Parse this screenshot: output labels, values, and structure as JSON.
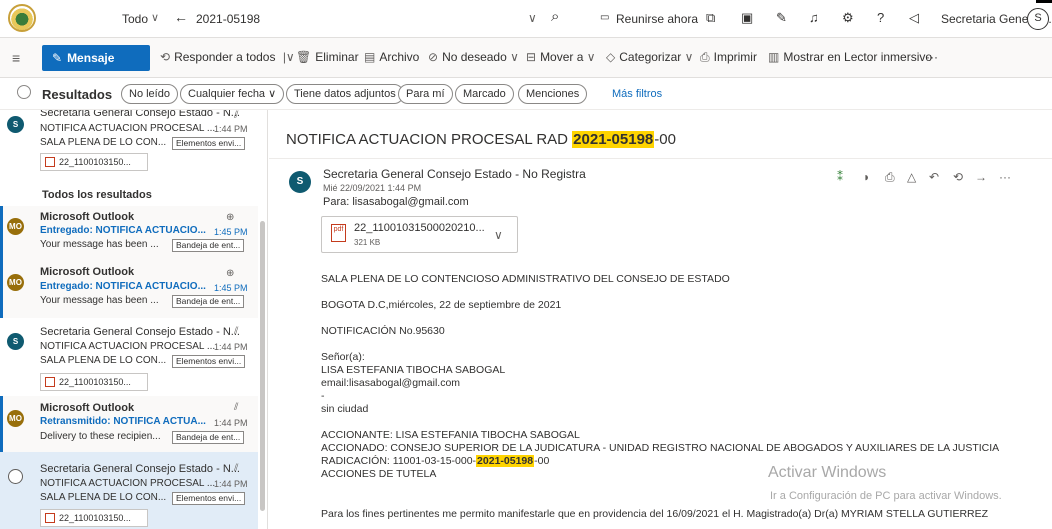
{
  "header": {
    "search_scope": "Todo",
    "search_query": "2021-05198",
    "meet_now": "Reunirse ahora",
    "user_name": "Secretaria General...",
    "user_initial": "S"
  },
  "commands": {
    "new_mail": "Mensaje nuevo",
    "reply_all": "Responder a todos",
    "delete": "Eliminar",
    "archive": "Archivo",
    "junk": "No deseado",
    "move_to": "Mover a",
    "categorize": "Categorizar",
    "print": "Imprimir",
    "immersive_reader": "Mostrar en Lector inmersivo",
    "more": "···"
  },
  "filters": {
    "results_label": "Resultados",
    "chips": [
      "No leído",
      "Cualquier fecha",
      "Tiene datos adjuntos",
      "Para mí",
      "Marcado",
      "Menciones"
    ],
    "more_filters": "Más filtros"
  },
  "list": {
    "section_title": "Todos los resultados",
    "top_item": {
      "sender": "Secretaria General Consejo Estado - N...",
      "subject": "NOTIFICA ACTUACION PROCESAL ...",
      "time": "1:44 PM",
      "preview": "SALA PLENA DE LO CON...",
      "folder": "Elementos envi...",
      "attachment": "22_1100103150...",
      "avatar": "S"
    },
    "items": [
      {
        "sender": "Microsoft Outlook",
        "subject": "Entregado: NOTIFICA ACTUACIO...",
        "time": "1:45 PM",
        "preview": "Your message has been ...",
        "folder": "Bandeja de ent...",
        "avatar": "MO"
      },
      {
        "sender": "Microsoft Outlook",
        "subject": "Entregado: NOTIFICA ACTUACIO...",
        "time": "1:45 PM",
        "preview": "Your message has been ...",
        "folder": "Bandeja de ent...",
        "avatar": "MO"
      },
      {
        "sender": "Secretaria General Consejo Estado - N...",
        "subject": "NOTIFICA ACTUACION PROCESAL ...",
        "time": "1:44 PM",
        "preview": "SALA PLENA DE LO CON...",
        "folder": "Elementos envi...",
        "attachment": "22_1100103150...",
        "avatar": "S"
      },
      {
        "sender": "Microsoft Outlook",
        "subject": "Retransmitido: NOTIFICA ACTUA...",
        "time": "1:44 PM",
        "preview": "Delivery to these recipien...",
        "folder": "Bandeja de ent...",
        "avatar": "MO"
      },
      {
        "sender": "Secretaria General Consejo Estado - N...",
        "subject": "NOTIFICA ACTUACION PROCESAL ...",
        "time": "1:44 PM",
        "preview": "SALA PLENA DE LO CON...",
        "folder": "Elementos envi...",
        "attachment": "22_1100103150..."
      }
    ]
  },
  "reading": {
    "subject_prefix": "NOTIFICA ACTUACION PROCESAL RAD ",
    "subject_highlight": "2021-05198",
    "subject_suffix": "-00",
    "from": "Secretaria General Consejo Estado - No Registra",
    "date": "Mié 22/09/2021 1:44 PM",
    "to": "Para: lisasabogal@gmail.com",
    "avatar": "S",
    "attachment_name": "22_11001031500020210...",
    "attachment_size": "321 KB",
    "attachment_type": "pdf",
    "body": {
      "l1": "SALA PLENA DE LO CONTENCIOSO ADMINISTRATIVO DEL CONSEJO DE ESTADO",
      "l2": "BOGOTA D.C,miércoles, 22 de septiembre de 2021",
      "l3": "NOTIFICACIÓN No.95630",
      "l4": "Señor(a):",
      "l5": "LISA ESTEFANIA TIBOCHA SABOGAL",
      "l6": "email:lisasabogal@gmail.com",
      "l7": "-",
      "l8": "sin ciudad",
      "l9": "ACCIONANTE: LISA ESTEFANIA TIBOCHA SABOGAL",
      "l10": "ACCIONADO: CONSEJO SUPERIOR DE LA JUDICATURA - UNIDAD REGISTRO NACIONAL DE ABOGADOS Y AUXILIARES DE LA JUSTICIA",
      "l11_prefix": "RADICACIÓN: 11001-03-15-000-",
      "l11_highlight": "2021-05198",
      "l11_suffix": "-00",
      "l12": "ACCIONES DE TUTELA",
      "l13": "Para los fines pertinentes me permito manifestarle que en providencia del 16/09/2021  el H. Magistrado(a) Dr(a) MYRIAM STELLA GUTIERREZ"
    }
  },
  "watermark": {
    "title": "Activar Windows",
    "subtitle": "Ir a Configuración de PC para activar Windows."
  },
  "colors": {
    "accent": "#0f6cbd",
    "highlight": "#ffd400",
    "avatar_mo": "#986f0b",
    "avatar_s": "#0f5a70"
  }
}
